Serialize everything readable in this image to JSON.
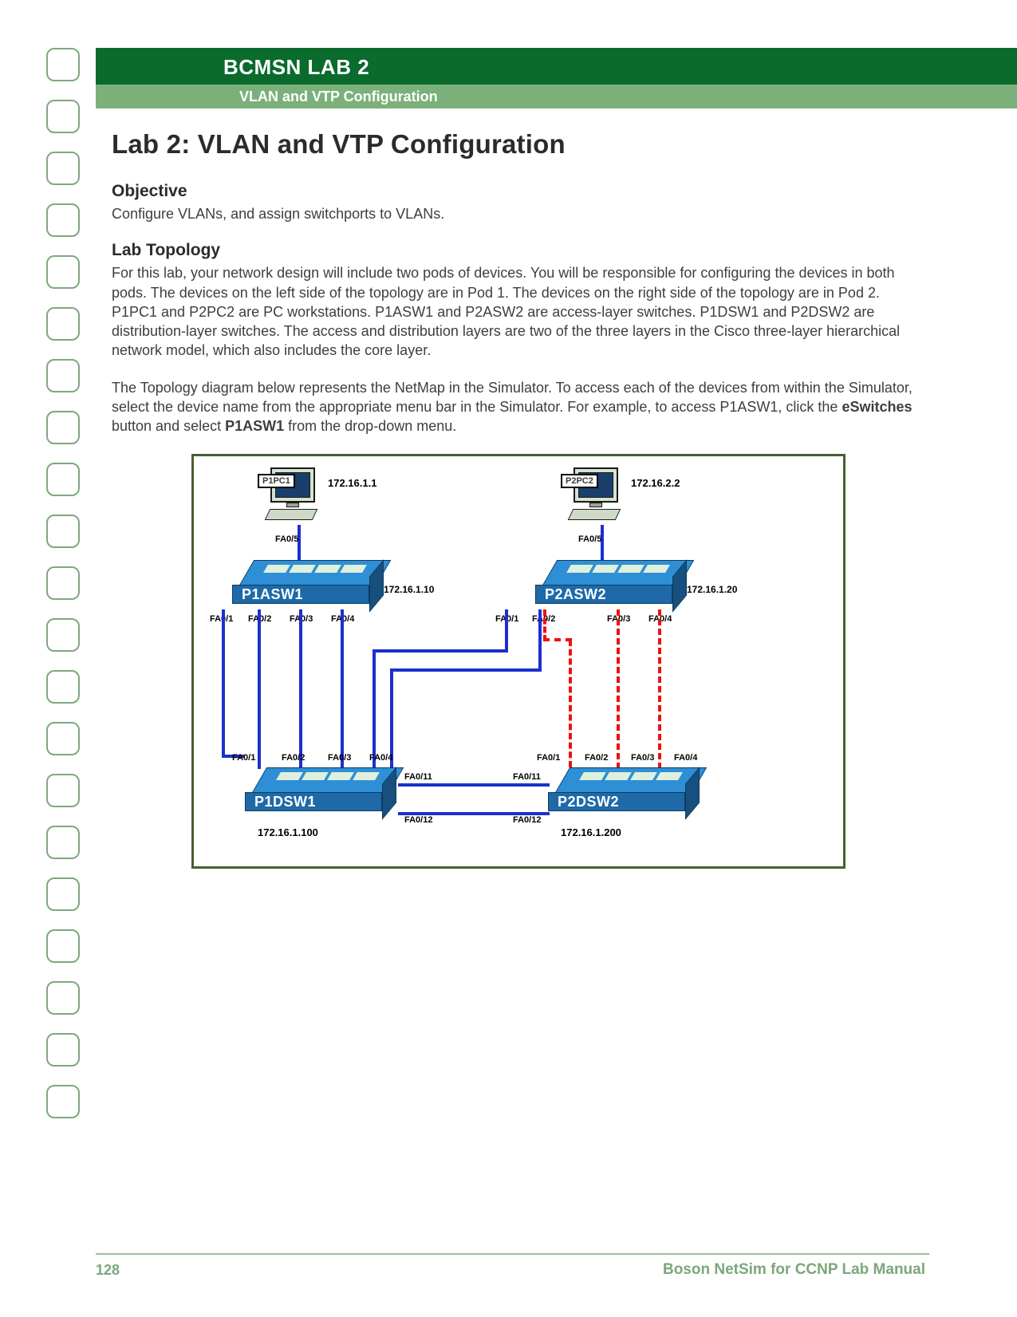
{
  "header": {
    "dark": "BCMSN LAB 2",
    "light": "VLAN and VTP Configuration"
  },
  "title": "Lab 2: VLAN and VTP Configuration",
  "sections": {
    "objective_h": "Objective",
    "objective_p": "Configure VLANs, and assign switchports to VLANs.",
    "topology_h": "Lab Topology",
    "topology_p1": "For this lab, your network design will include two pods of devices. You  will be responsible for configuring the devices in both pods. The devices on the left side of the topology are in Pod 1. The devices on the right side of the topology are in Pod 2. P1PC1 and P2PC2 are PC workstations. P1ASW1 and P2ASW2 are access-layer switches. P1DSW1 and P2DSW2 are distribution-layer switches. The access and distribution layers are two of the three layers in the Cisco three-layer hierarchical network model, which also includes the core layer.",
    "topology_p2a": "The Topology diagram below represents the NetMap in the Simulator. To access each of the devices from within the Simulator, select the device name from the appropriate menu bar in the Simulator. For example, to access P1ASW1, click the ",
    "topology_p2b": "eSwitches",
    "topology_p2c": " button and select ",
    "topology_p2d": "P1ASW1",
    "topology_p2e": " from the drop-down menu."
  },
  "diagram": {
    "p1pc1": "P1PC1",
    "p1pc1_ip": "172.16.1.1",
    "p2pc2": "P2PC2",
    "p2pc2_ip": "172.16.2.2",
    "fa05_l": "FA0/5",
    "fa05_r": "FA0/5",
    "p1asw1": "P1ASW1",
    "p1asw1_ip": "172.16.1.10",
    "p2asw2": "P2ASW2",
    "p2asw2_ip": "172.16.1.20",
    "fa0_1": "FA0/1",
    "fa0_2": "FA0/2",
    "fa0_3": "FA0/3",
    "fa0_4": "FA0/4",
    "fa0_1b": "FA0/1",
    "fa0_2b": "FA0/2",
    "fa0_3b": "FA0/3",
    "fa0_4b": "FA0/4",
    "b_fa01": "FA0/1",
    "b_fa02": "FA0/2",
    "b_fa03": "FA0/3",
    "b_fa04": "FA0/4",
    "b_fa01r": "FA0/1",
    "b_fa02r": "FA0/2",
    "b_fa03r": "FA0/3",
    "b_fa04r": "FA0/4",
    "fa011": "FA0/11",
    "fa011r": "FA0/11",
    "fa012": "FA0/12",
    "fa012r": "FA0/12",
    "p1dsw1": "P1DSW1",
    "p1dsw1_ip": "172.16.1.100",
    "p2dsw2": "P2DSW2",
    "p2dsw2_ip": "172.16.1.200"
  },
  "footer": {
    "page": "128",
    "text": "Boson NetSim for CCNP Lab Manual"
  }
}
